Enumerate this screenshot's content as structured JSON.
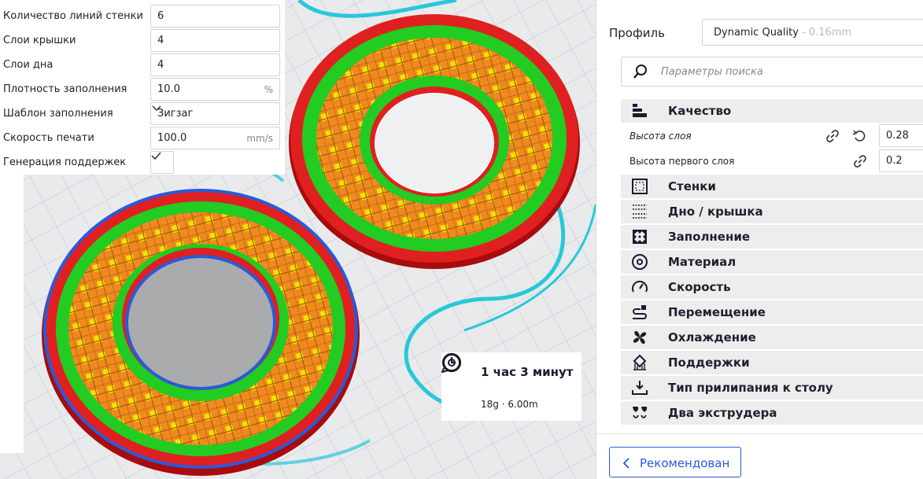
{
  "quick_settings": {
    "rows": [
      {
        "label": "Количество линий стенки",
        "value": "6",
        "unit": ""
      },
      {
        "label": "Слои крышки",
        "value": "4",
        "unit": ""
      },
      {
        "label": "Слои дна",
        "value": "4",
        "unit": ""
      },
      {
        "label": "Плотность заполнения",
        "value": "10.0",
        "unit": "%"
      },
      {
        "label": "Шаблон заполнения",
        "value": "Зигзаг",
        "unit": ""
      },
      {
        "label": "Скорость печати",
        "value": "100.0",
        "unit": "mm/s"
      },
      {
        "label": "Генерация поддержек",
        "checked": true
      }
    ]
  },
  "estimate": {
    "time": "1 час 3 минут",
    "material": "18g · 6.00m",
    "time_icon": "clock-icon",
    "material_icon": "spool-icon"
  },
  "profile": {
    "label": "Профиль",
    "name": "Dynamic Quality",
    "layer_height": " - 0.16mm"
  },
  "search": {
    "placeholder": "Параметры поиска"
  },
  "categories": [
    {
      "label": "Качество",
      "icon": "quality-icon"
    },
    {
      "label": "Стенки",
      "icon": "walls-icon"
    },
    {
      "label": "Дно / крышка",
      "icon": "top-bottom-icon"
    },
    {
      "label": "Заполнение",
      "icon": "infill-icon"
    },
    {
      "label": "Материал",
      "icon": "material-icon"
    },
    {
      "label": "Скорость",
      "icon": "speed-icon"
    },
    {
      "label": "Перемещение",
      "icon": "travel-icon"
    },
    {
      "label": "Охлаждение",
      "icon": "fan-icon"
    },
    {
      "label": "Поддержки",
      "icon": "support-icon"
    },
    {
      "label": "Тип прилипания к столу",
      "icon": "adhesion-icon"
    },
    {
      "label": "Два экструдера",
      "icon": "dual-extrusion-icon"
    }
  ],
  "quality_settings": [
    {
      "label": "Высота слоя",
      "value": "0.28",
      "linked": true,
      "modified": true
    },
    {
      "label": "Высота первого слоя",
      "value": "0.2",
      "linked": true,
      "modified": false
    }
  ],
  "footer": {
    "recommended_label": "Рекомендован"
  },
  "colors": {
    "accent": "#2a5ad8",
    "shell_red": "#e02020",
    "wall_green": "#22cc22",
    "infill_orange": "#f08a1e",
    "skin_yellow": "#f2e200",
    "support_cyan": "#28c8d8"
  }
}
